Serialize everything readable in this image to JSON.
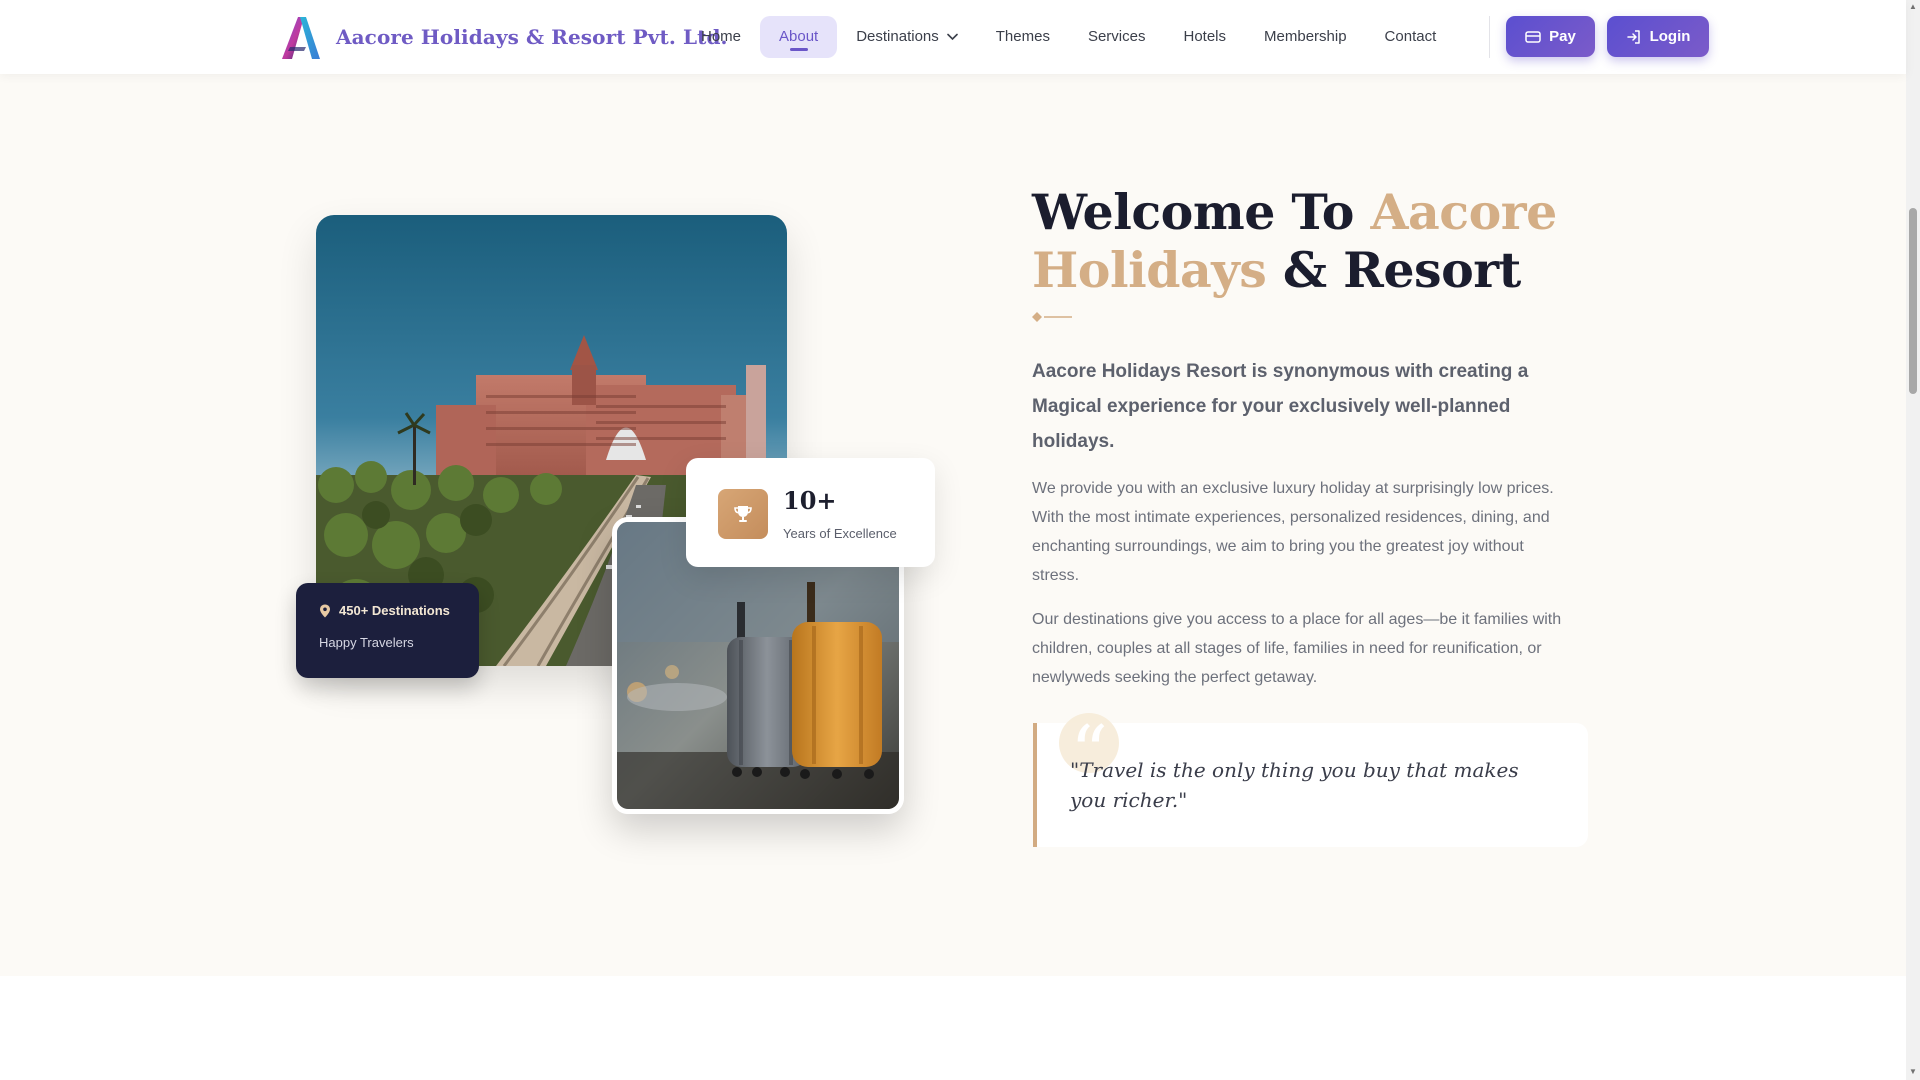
{
  "brand": {
    "name": "Aacore Holidays & Resort Pvt. Ltd.",
    "logo_icon": "aacore-logo-mark"
  },
  "nav": {
    "items": [
      {
        "label": "Home"
      },
      {
        "label": "About",
        "active": true
      },
      {
        "label": "Destinations",
        "has_dropdown": true
      },
      {
        "label": "Themes"
      },
      {
        "label": "Services"
      },
      {
        "label": "Hotels"
      },
      {
        "label": "Membership"
      },
      {
        "label": "Contact"
      }
    ],
    "pay_label": "Pay",
    "login_label": "Login"
  },
  "hero": {
    "badge_destinations": {
      "title": "450+ Destinations",
      "subtitle": "Happy Travelers",
      "icon": "map-pin-icon"
    },
    "badge_years": {
      "value": "10+",
      "label": "Years of Excellence",
      "icon": "trophy-icon"
    }
  },
  "about": {
    "title_part1": "Welcome To ",
    "title_highlight": "Aacore Holidays",
    "title_part2": " & Resort",
    "lead": "Aacore Holidays Resort is synonymous with creating a Magical experience for your exclusively well-planned holidays.",
    "paragraph1": "We provide you with an exclusive luxury holiday at surprisingly low prices. With the most intimate experiences, personalized residences, dining, and enchanting surroundings, we aim to bring you the greatest joy without stress.",
    "paragraph2": "Our destinations give you access to a place for all ages—be it families with children, couples at all stages of life, families in need for reunification, or newlyweds seeking the perfect getaway.",
    "quote": "\"Travel is the only thing you buy that makes you richer.\""
  },
  "colors": {
    "brand_purple": "#6f5bc4",
    "accent_gold": "#d4ae86",
    "navy_badge": "#1c1f3d",
    "section_bg": "#fcfaf6"
  }
}
